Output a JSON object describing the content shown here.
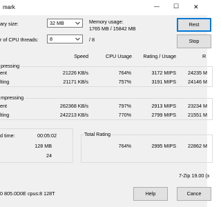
{
  "window": {
    "title": "mark",
    "minimize_glyph": "—",
    "maximize_glyph": "☐",
    "close_glyph": "✕"
  },
  "settings": {
    "dictionary_label": "ary size:",
    "dictionary_value": "32 MB",
    "threads_label": "r of CPU threads:",
    "threads_value": "8",
    "threads_total": "/ 8",
    "memory_label": "Memory usage:",
    "memory_value": "1765 MB / 15842 MB"
  },
  "buttons": {
    "restart": "Rest",
    "stop": "Stop",
    "help": "Help",
    "cancel": "Cance"
  },
  "table": {
    "headers": [
      "Speed",
      "CPU Usage",
      "Rating / Usage",
      "R"
    ],
    "compressing": {
      "title": "pressing",
      "rows": [
        {
          "label": "ent",
          "speed": "21226 KB/s",
          "cpu": "764%",
          "rpu": "3172 MIPS",
          "rating": "24235 M"
        },
        {
          "label": "lting",
          "speed": "21171 KB/s",
          "cpu": "757%",
          "rpu": "3191 MIPS",
          "rating": "24146 M"
        }
      ]
    },
    "decompressing": {
      "title": "mpressing",
      "rows": [
        {
          "label": "ent",
          "speed": "262368 KB/s",
          "cpu": "797%",
          "rpu": "2913 MIPS",
          "rating": "23234 M"
        },
        {
          "label": "lting",
          "speed": "242213 KB/s",
          "cpu": "770%",
          "rpu": "2799 MIPS",
          "rating": "21551 M"
        }
      ]
    }
  },
  "summary": {
    "elapsed_label": "d time:",
    "elapsed_value": "00:05:02",
    "size_value": "128 MB",
    "passes_value": "24",
    "total_label": "Total Rating",
    "total_cpu": "764%",
    "total_rpu": "2995 MIPS",
    "total_rating": "22862 M"
  },
  "footer": {
    "version": "7-Zip 19.00 (x",
    "cpu_info": "0 805.0D0E cpus:8 128T"
  }
}
